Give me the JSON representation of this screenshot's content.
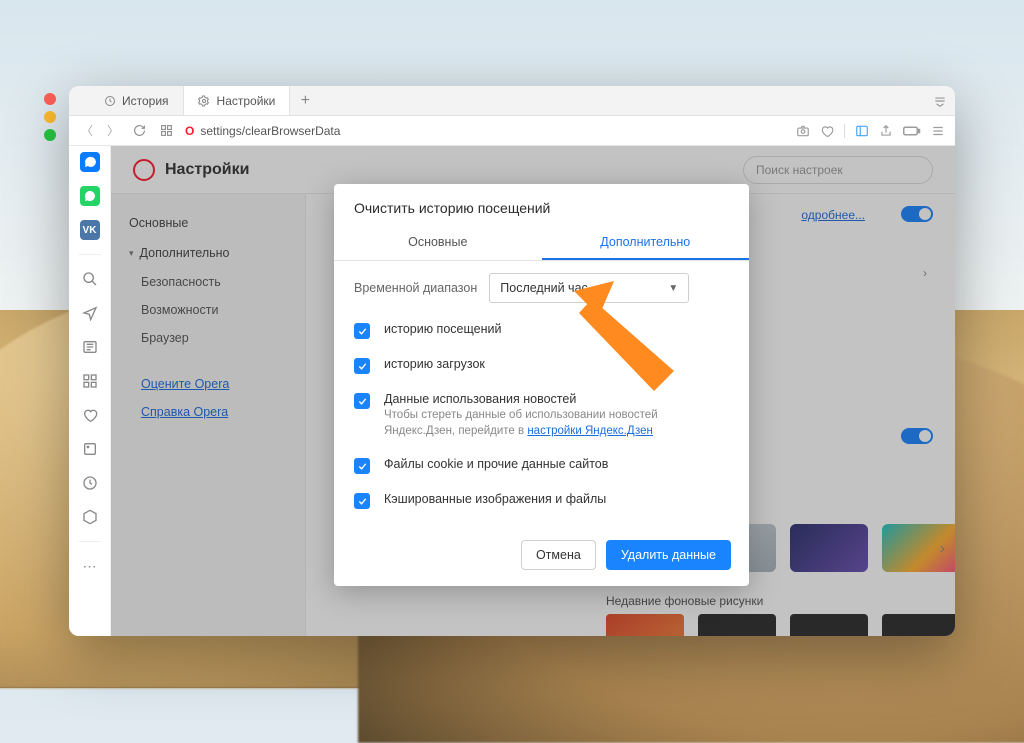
{
  "tabs": {
    "history": "История",
    "settings": "Настройки"
  },
  "address": {
    "url": "settings/clearBrowserData"
  },
  "settings": {
    "title": "Настройки",
    "search_ph": "Поиск настроек",
    "nav": {
      "basic": "Основные",
      "advanced": "Дополнительно",
      "security": "Безопасность",
      "features": "Возможности",
      "browser": "Браузер",
      "rate": "Оцените Opera",
      "help": "Справка Opera"
    },
    "more": "одробнее...",
    "recent": "Недавние фоновые рисунки"
  },
  "modal": {
    "title": "Очистить историю посещений",
    "tab_basic": "Основные",
    "tab_advanced": "Дополнительно",
    "range_label": "Временной диапазон",
    "range_value": "Последний час",
    "items": {
      "history": "историю посещений",
      "downloads": "историю загрузок",
      "news_title": "Данные использования новостей",
      "news_sub1": "Чтобы стереть данные об использовании новостей Яндекс.Дзен, перейдите в ",
      "news_link": "настройки Яндекс.Дзен",
      "cookies": "Файлы cookie и прочие данные сайтов",
      "cache": "Кэшированные изображения и файлы"
    },
    "cancel": "Отмена",
    "confirm": "Удалить данные"
  }
}
